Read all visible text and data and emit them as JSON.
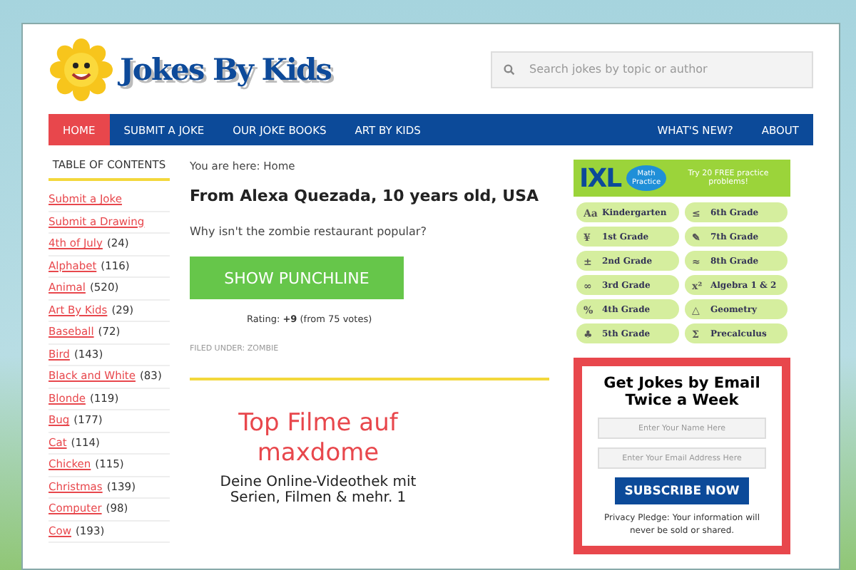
{
  "logo": {
    "text": "Jokes By Kids"
  },
  "search": {
    "placeholder": "Search jokes by topic or author"
  },
  "nav": {
    "left": [
      {
        "label": "HOME",
        "selected": true
      },
      {
        "label": "SUBMIT A JOKE",
        "selected": false
      },
      {
        "label": "OUR JOKE BOOKS",
        "selected": false
      },
      {
        "label": "ART BY KIDS",
        "selected": false
      }
    ],
    "right": [
      {
        "label": "WHAT'S NEW?",
        "selected": false
      },
      {
        "label": "ABOUT",
        "selected": false
      }
    ]
  },
  "sidebar": {
    "title": "TABLE OF CONTENTS",
    "items": [
      {
        "label": "Submit a Joke"
      },
      {
        "label": "Submit a Drawing"
      },
      {
        "label": "4th of July",
        "count": "(24)"
      },
      {
        "label": "Alphabet",
        "count": "(116)"
      },
      {
        "label": "Animal",
        "count": "(520)"
      },
      {
        "label": "Art By Kids",
        "count": "(29)"
      },
      {
        "label": "Baseball",
        "count": "(72)"
      },
      {
        "label": "Bird",
        "count": "(143)"
      },
      {
        "label": "Black and White",
        "count": "(83)"
      },
      {
        "label": "Blonde",
        "count": "(119)"
      },
      {
        "label": "Bug",
        "count": "(177)"
      },
      {
        "label": "Cat",
        "count": "(114)"
      },
      {
        "label": "Chicken",
        "count": "(115)"
      },
      {
        "label": "Christmas",
        "count": "(139)"
      },
      {
        "label": "Computer",
        "count": "(98)"
      },
      {
        "label": "Cow",
        "count": "(193)"
      }
    ]
  },
  "main": {
    "breadcrumb": "You are here: Home",
    "title": "From Alexa Quezada, 10 years old, USA",
    "question": "Why isn't the zombie restaurant popular?",
    "button": "SHOW PUNCHLINE",
    "rating": "Rating: **+9** (from 75 votes)",
    "filed": "FILED UNDER: ZOMBIE",
    "ad_title": "Top Filme auf maxdome",
    "ad_text": "Deine Online-Videothek mit Serien, Filmen & mehr. 1"
  },
  "ixl_ad": {
    "logo": "IXL",
    "badge": "Math Practice",
    "tagline": "Try 20 FREE practice problems!",
    "grades": [
      {
        "symbol": "Aa",
        "label": "Kindergarten"
      },
      {
        "symbol": "≤",
        "label": "6th Grade"
      },
      {
        "symbol": "¥",
        "label": "1st Grade"
      },
      {
        "symbol": "✎",
        "label": "7th Grade"
      },
      {
        "symbol": "±",
        "label": "2nd Grade"
      },
      {
        "symbol": "≈",
        "label": "8th Grade"
      },
      {
        "symbol": "∞",
        "label": "3rd Grade"
      },
      {
        "symbol": "x²",
        "label": "Algebra 1 & 2"
      },
      {
        "symbol": "%",
        "label": "4th Grade"
      },
      {
        "symbol": "△",
        "label": "Geometry"
      },
      {
        "symbol": "♣",
        "label": "5th Grade"
      },
      {
        "symbol": "Σ",
        "label": "Precalculus"
      }
    ]
  },
  "subscribe": {
    "title": "Get Jokes by Email Twice a Week",
    "name_placeholder": "Enter Your Name Here",
    "email_placeholder": "Enter Your Email Address Here",
    "button": "SUBSCRIBE NOW",
    "note": "Privacy Pledge: Your information will never be sold or shared."
  }
}
